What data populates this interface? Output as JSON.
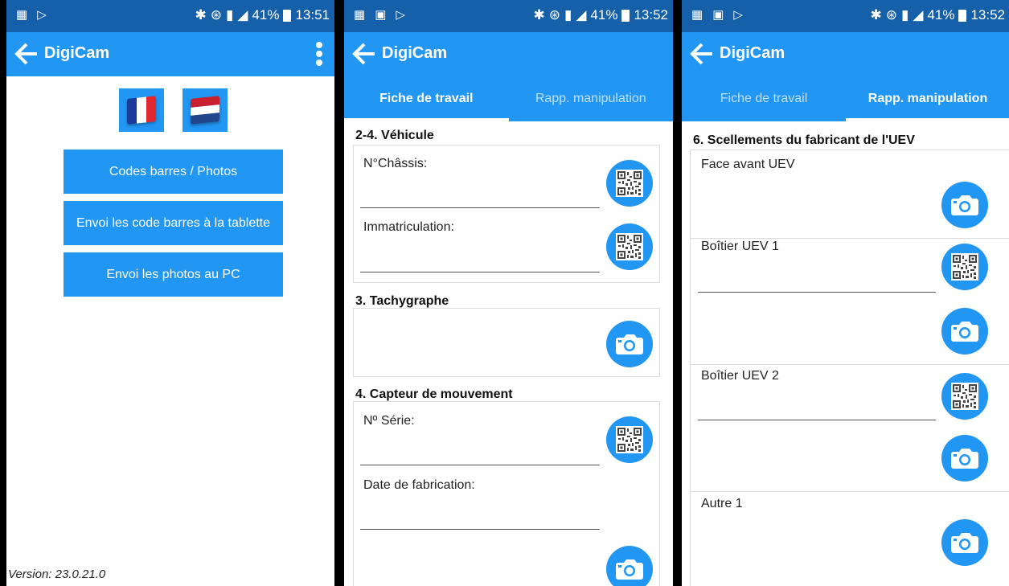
{
  "status": {
    "left_icons": [
      "calendar-icon",
      "play-store-icon"
    ],
    "left_icons_s2": [
      "calendar-icon",
      "gallery-icon",
      "play-store-icon"
    ],
    "battery": "41%",
    "time1": "13:51",
    "time2": "13:52",
    "time3": "13:52"
  },
  "app": {
    "title": "DigiCam"
  },
  "home": {
    "buttons": [
      "Codes barres / Photos",
      "Envoi les code barres à la tablette",
      "Envoi les photos au PC"
    ],
    "version": "Version: 23.0.21.0"
  },
  "tabs": [
    "Fiche de travail",
    "Rapp. manipulation"
  ],
  "fiche": {
    "sec1": "2-4. Véhicule",
    "chassis": "N°Châssis:",
    "immat": "Immatriculation:",
    "sec2": "3. Tachygraphe",
    "sec3": "4. Capteur de mouvement",
    "serie": "Nº Série:",
    "date": "Date de fabrication:"
  },
  "rapp": {
    "sec": "6. Scellements du fabricant de l'UEV",
    "items": [
      "Face avant UEV",
      "Boîtier UEV 1",
      "Boîtier UEV 2",
      "Autre 1"
    ]
  },
  "colors": {
    "primary": "#2196f3",
    "status": "#1560a8"
  }
}
